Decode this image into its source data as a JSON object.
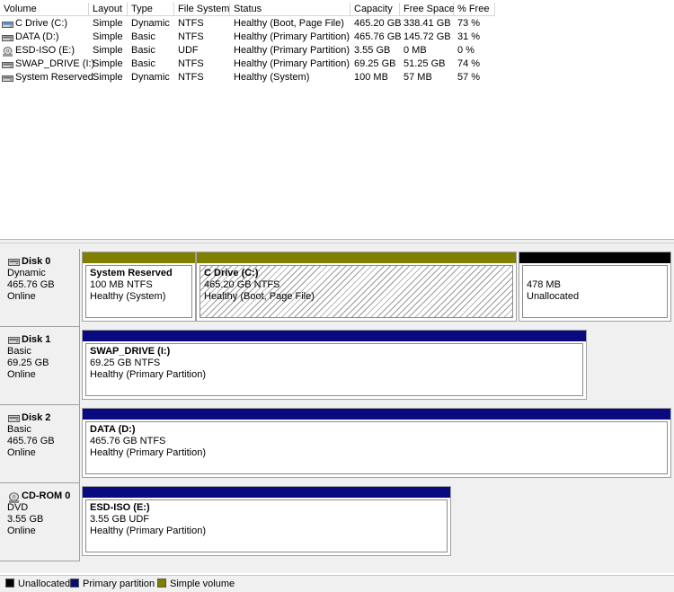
{
  "colors": {
    "unallocated": "#000000",
    "primary_partition": "#0a0a80",
    "simple_volume": "#808000"
  },
  "volume_table": {
    "columns": [
      "Volume",
      "Layout",
      "Type",
      "File System",
      "Status",
      "Capacity",
      "Free Space",
      "% Free"
    ],
    "rows": [
      {
        "icon": "dynamic-volume-icon",
        "volume": "C Drive (C:)",
        "layout": "Simple",
        "type": "Dynamic",
        "fs": "NTFS",
        "status": "Healthy (Boot, Page File)",
        "capacity": "465.20 GB",
        "free": "338.41 GB",
        "pct": "73 %"
      },
      {
        "icon": "basic-volume-icon",
        "volume": "DATA (D:)",
        "layout": "Simple",
        "type": "Basic",
        "fs": "NTFS",
        "status": "Healthy (Primary Partition)",
        "capacity": "465.76 GB",
        "free": "145.72 GB",
        "pct": "31 %"
      },
      {
        "icon": "optical-disc-icon",
        "volume": "ESD-ISO (E:)",
        "layout": "Simple",
        "type": "Basic",
        "fs": "UDF",
        "status": "Healthy (Primary Partition)",
        "capacity": "3.55 GB",
        "free": "0 MB",
        "pct": "0 %"
      },
      {
        "icon": "basic-volume-icon",
        "volume": "SWAP_DRIVE (I:)",
        "layout": "Simple",
        "type": "Basic",
        "fs": "NTFS",
        "status": "Healthy (Primary Partition)",
        "capacity": "69.25 GB",
        "free": "51.25 GB",
        "pct": "74 %"
      },
      {
        "icon": "basic-volume-icon",
        "volume": "System Reserved",
        "layout": "Simple",
        "type": "Dynamic",
        "fs": "NTFS",
        "status": "Healthy (System)",
        "capacity": "100 MB",
        "free": "57 MB",
        "pct": "57 %"
      }
    ]
  },
  "disks": [
    {
      "name": "Disk 0",
      "kind": "Dynamic",
      "size": "465.76 GB",
      "state": "Online",
      "partitions": [
        {
          "name": "System Reserved",
          "size_fs": "100 MB NTFS",
          "status": "Healthy (System)",
          "type": "simple_volume"
        },
        {
          "name": "C Drive  (C:)",
          "size_fs": "465.20 GB NTFS",
          "status": "Healthy (Boot, Page File)",
          "type": "simple_volume"
        },
        {
          "name": "",
          "size_fs": "478 MB",
          "status": "Unallocated",
          "type": "unallocated"
        }
      ]
    },
    {
      "name": "Disk 1",
      "kind": "Basic",
      "size": "69.25 GB",
      "state": "Online",
      "partitions": [
        {
          "name": "SWAP_DRIVE  (I:)",
          "size_fs": "69.25 GB NTFS",
          "status": "Healthy (Primary Partition)",
          "type": "primary_partition"
        }
      ]
    },
    {
      "name": "Disk 2",
      "kind": "Basic",
      "size": "465.76 GB",
      "state": "Online",
      "partitions": [
        {
          "name": "DATA  (D:)",
          "size_fs": "465.76 GB NTFS",
          "status": "Healthy (Primary Partition)",
          "type": "primary_partition"
        }
      ]
    },
    {
      "name": "CD-ROM 0",
      "kind": "DVD",
      "size": "3.55 GB",
      "state": "Online",
      "partitions": [
        {
          "name": "ESD-ISO  (E:)",
          "size_fs": "3.55 GB UDF",
          "status": "Healthy (Primary Partition)",
          "type": "primary_partition"
        }
      ]
    }
  ],
  "legend": [
    {
      "label": "Unallocated",
      "type": "unallocated"
    },
    {
      "label": "Primary partition",
      "type": "primary_partition"
    },
    {
      "label": "Simple volume",
      "type": "simple_volume"
    }
  ]
}
